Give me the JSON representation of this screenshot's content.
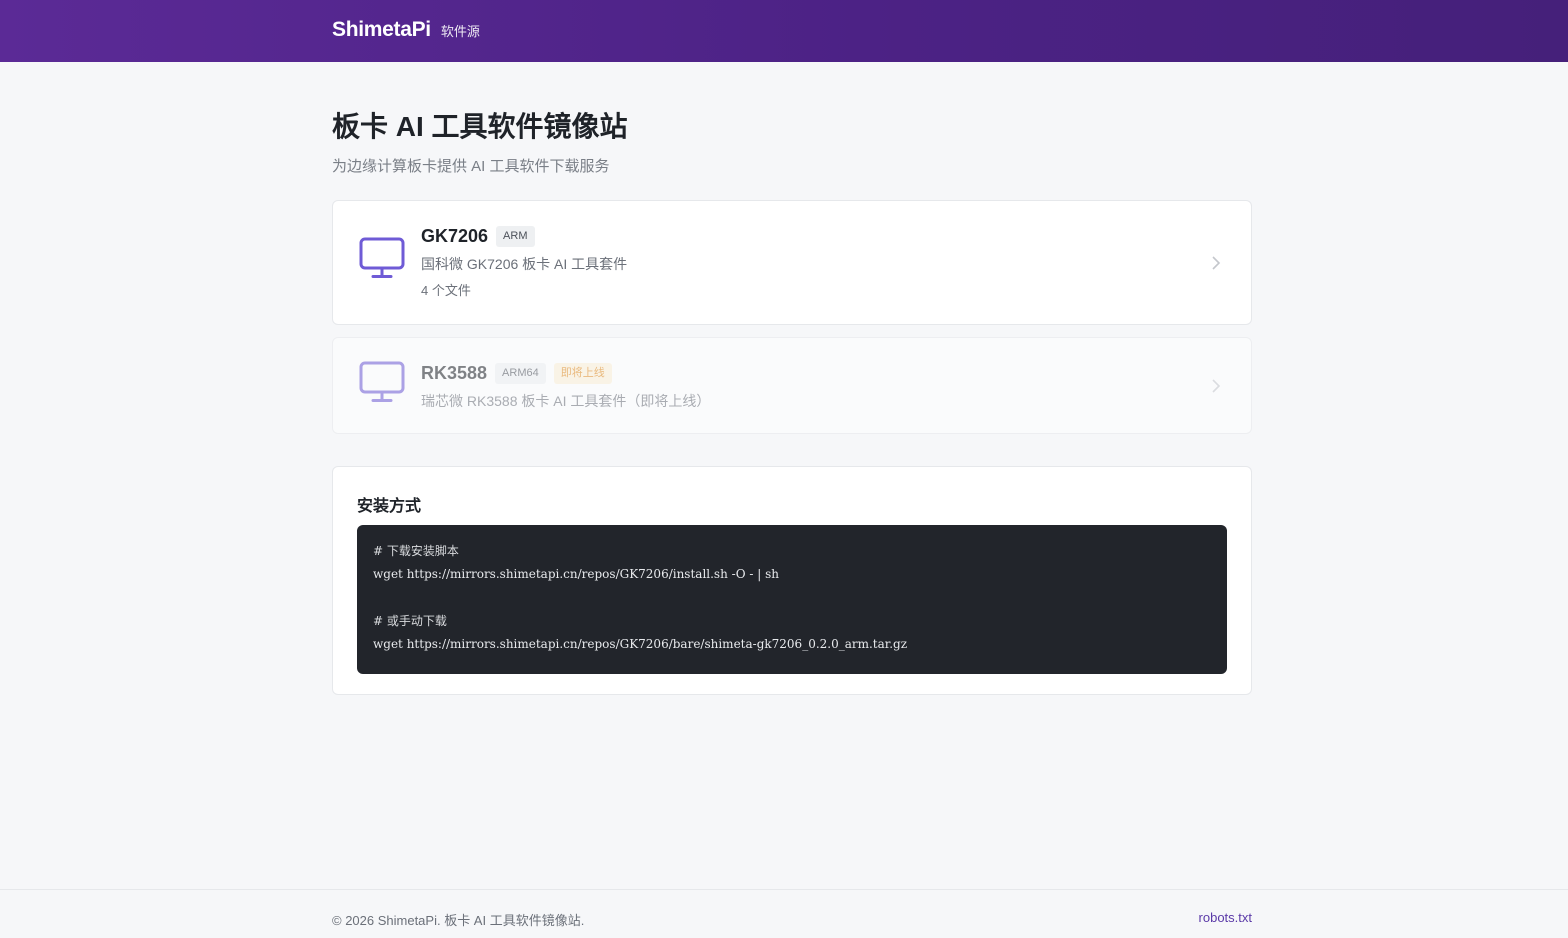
{
  "header": {
    "brand": "ShimetaPi",
    "brand_sub": "软件源"
  },
  "page": {
    "title": "板卡 AI 工具软件镜像站",
    "subtitle": "为边缘计算板卡提供 AI 工具软件下载服务"
  },
  "boards": [
    {
      "name": "GK7206",
      "arch": "ARM",
      "description": "国科微 GK7206 板卡 AI 工具套件",
      "files": "4 个文件",
      "icon": "monitor-icon"
    },
    {
      "name": "RK3588",
      "arch": "ARM64",
      "badge": "即将上线",
      "description": "瑞芯微 RK3588 板卡 AI 工具套件（即将上线）",
      "icon": "monitor-icon"
    }
  ],
  "install": {
    "title": "安装方式",
    "code": [
      "# 下载安装脚本",
      "wget https://mirrors.shimetapi.cn/repos/GK7206/install.sh -O - | sh",
      "",
      "# 或手动下载",
      "wget https://mirrors.shimetapi.cn/repos/GK7206/bare/shimeta-gk7206_0.2.0_arm.tar.gz"
    ]
  },
  "footer": {
    "copyright": "© 2026 ShimetaPi. 板卡 AI 工具软件镜像站.",
    "link": "robots.txt"
  },
  "colors": {
    "header_start": "#5b2a96",
    "header_end": "#45207a",
    "accent": "#6f5bd6",
    "soon_badge": "#e08a1c",
    "code_bg": "#22252b"
  }
}
